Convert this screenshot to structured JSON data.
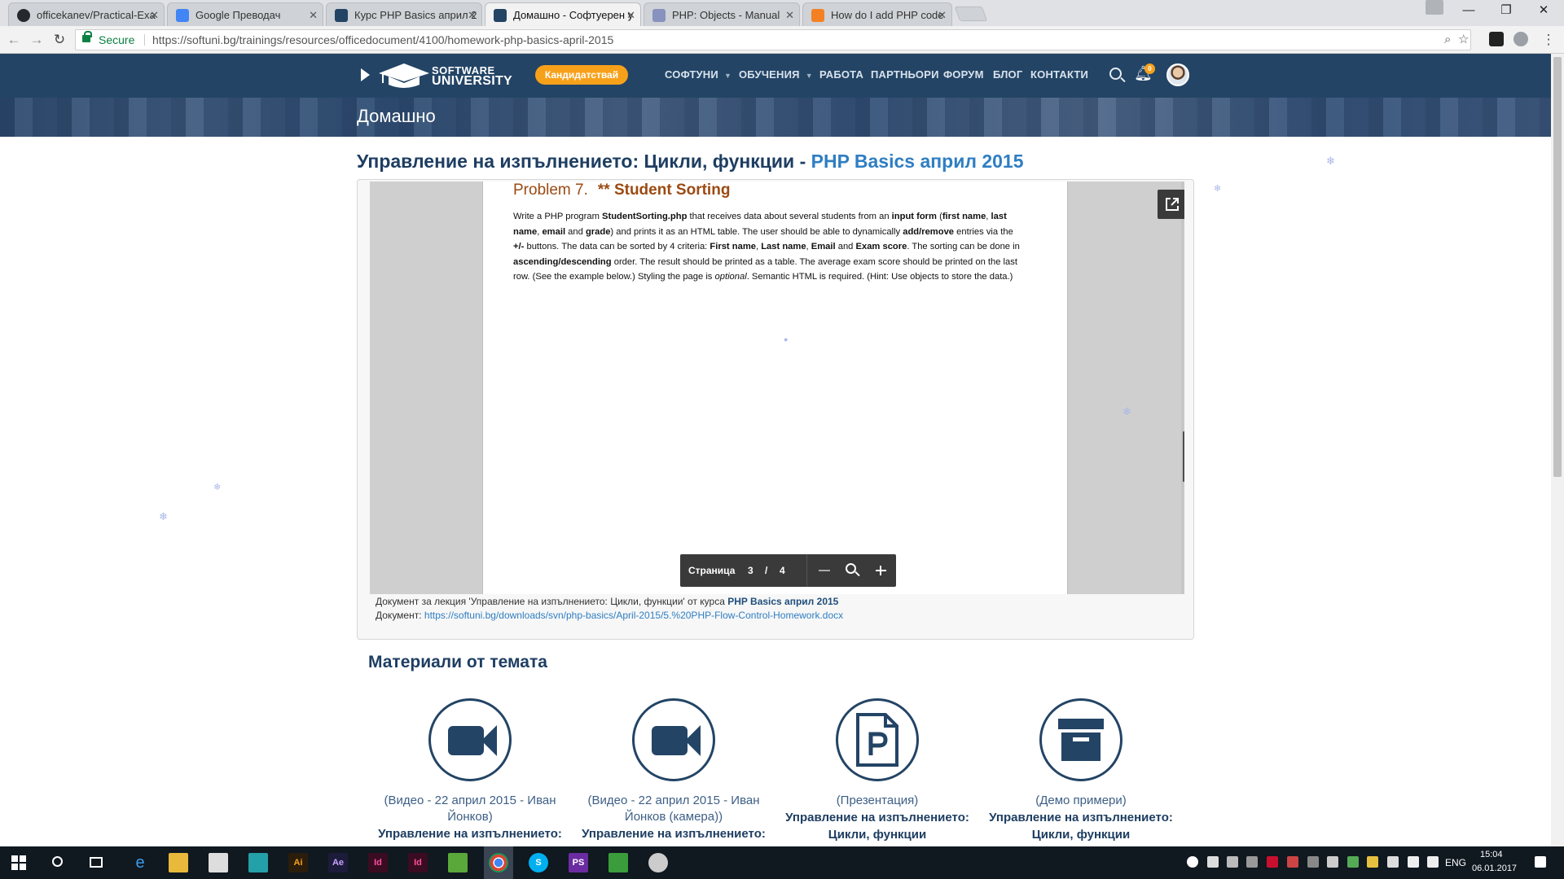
{
  "browser": {
    "tabs": [
      {
        "title": "officekanev/Practical-Exa",
        "color": "#24292e"
      },
      {
        "title": "Google Преводач",
        "color": "#4285f4"
      },
      {
        "title": "Курс PHP Basics април 2",
        "color": "#234465"
      },
      {
        "title": "Домашно - Софтуерен у",
        "color": "#234465"
      },
      {
        "title": "PHP: Objects - Manual",
        "color": "#8892bf"
      },
      {
        "title": "How do I add PHP code",
        "color": "#f48024"
      }
    ],
    "secure_label": "Secure",
    "url": "https://softuni.bg/trainings/resources/officedocument/4100/homework-php-basics-april-2015"
  },
  "site": {
    "logo_line1": "SOFTWARE",
    "logo_line2": "UNIVERSITY",
    "apply_button": "Кандидатствай",
    "nav": [
      "СОФТУНИ",
      "ОБУЧЕНИЯ",
      "РАБОТА",
      "ПАРТНЬОРИ",
      "ФОРУМ",
      "БЛОГ",
      "КОНТАКТИ"
    ],
    "notifications": "0"
  },
  "banner": {
    "title": "Домашно"
  },
  "heading": {
    "topic": "Управление на изпълнението: Цикли, функции - ",
    "course": "PHP Basics април 2015"
  },
  "document": {
    "problem_number": "Problem 7.",
    "problem_name": "** Student Sorting",
    "pager_label": "Страница",
    "page_current": "3",
    "page_separator": "/",
    "page_total": "4",
    "caption_prefix": "Документ за лекция 'Управление на изпълнението: Цикли, функции' от курса ",
    "caption_course": "PHP Basics април 2015",
    "caption_doc_label": "Документ: ",
    "caption_doc_link": "https://softuni.bg/downloads/svn/php-basics/April-2015/5.%20PHP-Flow-Control-Homework.docx"
  },
  "materials": {
    "heading": "Материали от темата",
    "items": [
      {
        "type": "(Видео - 22 април 2015 - Иван Йонков)",
        "name": "Управление на изпълнението:",
        "icon": "video-camera-icon"
      },
      {
        "type": "(Видео - 22 април 2015 - Иван Йонков (камера))",
        "name": "Управление на изпълнението:",
        "icon": "video-camera-icon"
      },
      {
        "type": "(Презентация)",
        "name": "Управление на изпълнението: Цикли, функции",
        "icon": "presentation-file-icon"
      },
      {
        "type": "(Демо примери)",
        "name": "Управление на изпълнението: Цикли, функции",
        "icon": "archive-box-icon"
      }
    ]
  },
  "taskbar": {
    "language": "ENG",
    "time": "15:04",
    "date": "06.01.2017"
  },
  "colors": {
    "nav_bg": "#234465",
    "accent_orange": "#f7a11a",
    "link_blue": "#2f7ec2",
    "heading_dark": "#1e3e62"
  }
}
